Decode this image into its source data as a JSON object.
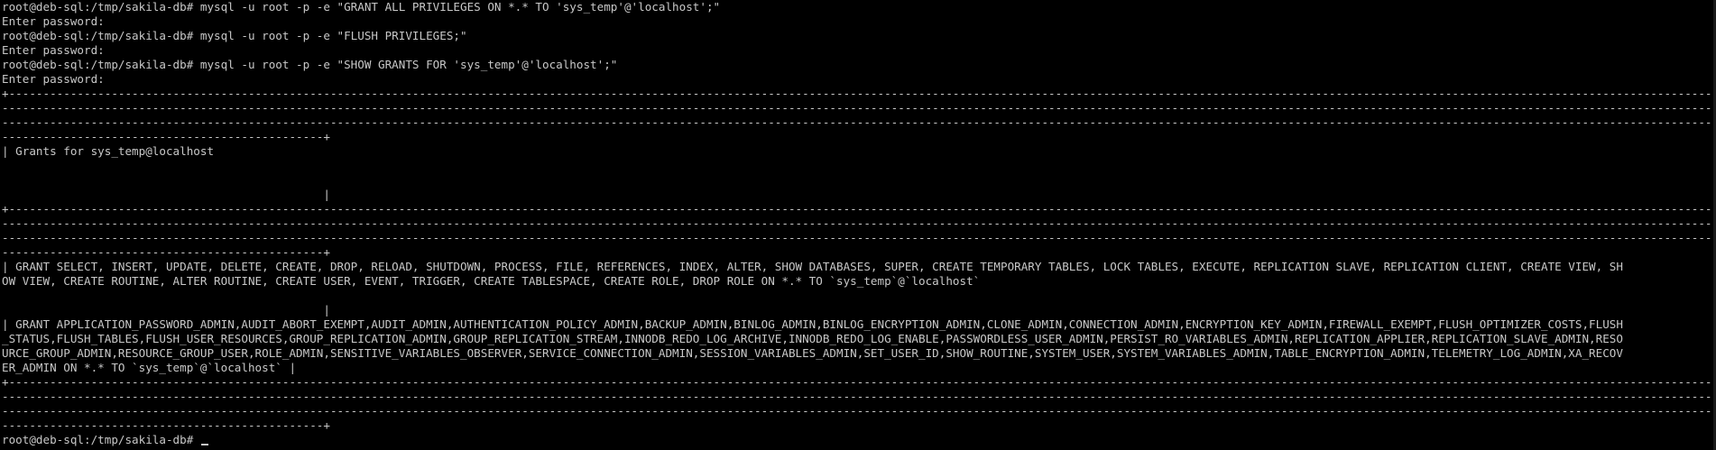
{
  "terminal": {
    "lines": [
      "root@deb-sql:/tmp/sakila-db# mysql -u root -p -e \"GRANT ALL PRIVILEGES ON *.* TO 'sys_temp'@'localhost';\"",
      "Enter password:",
      "root@deb-sql:/tmp/sakila-db# mysql -u root -p -e \"FLUSH PRIVILEGES;\"",
      "Enter password:",
      "root@deb-sql:/tmp/sakila-db# mysql -u root -p -e \"SHOW GRANTS FOR 'sys_temp'@'localhost';\"",
      "Enter password:",
      "+---------------------------------------------------------------------------------------------------------------------------------------------------------------------------------------------------------------------------------------------------------------------------",
      "-----------------------------------------------------------------------------------------------------------------------------------------------------------------------------------------------------------------------------------------------------------------------------",
      "-----------------------------------------------------------------------------------------------------------------------------------------------------------------------------------------------------------------------------------------------------------------------------",
      "-----------------------------------------------+",
      "| Grants for sys_temp@localhost",
      "",
      "",
      "                                               |",
      "+---------------------------------------------------------------------------------------------------------------------------------------------------------------------------------------------------------------------------------------------------------------------------",
      "-----------------------------------------------------------------------------------------------------------------------------------------------------------------------------------------------------------------------------------------------------------------------------",
      "-----------------------------------------------------------------------------------------------------------------------------------------------------------------------------------------------------------------------------------------------------------------------------",
      "-----------------------------------------------+",
      "| GRANT SELECT, INSERT, UPDATE, DELETE, CREATE, DROP, RELOAD, SHUTDOWN, PROCESS, FILE, REFERENCES, INDEX, ALTER, SHOW DATABASES, SUPER, CREATE TEMPORARY TABLES, LOCK TABLES, EXECUTE, REPLICATION SLAVE, REPLICATION CLIENT, CREATE VIEW, SH",
      "OW VIEW, CREATE ROUTINE, ALTER ROUTINE, CREATE USER, EVENT, TRIGGER, CREATE TABLESPACE, CREATE ROLE, DROP ROLE ON *.* TO `sys_temp`@`localhost`",
      "",
      "                                               |",
      "| GRANT APPLICATION_PASSWORD_ADMIN,AUDIT_ABORT_EXEMPT,AUDIT_ADMIN,AUTHENTICATION_POLICY_ADMIN,BACKUP_ADMIN,BINLOG_ADMIN,BINLOG_ENCRYPTION_ADMIN,CLONE_ADMIN,CONNECTION_ADMIN,ENCRYPTION_KEY_ADMIN,FIREWALL_EXEMPT,FLUSH_OPTIMIZER_COSTS,FLUSH",
      "_STATUS,FLUSH_TABLES,FLUSH_USER_RESOURCES,GROUP_REPLICATION_ADMIN,GROUP_REPLICATION_STREAM,INNODB_REDO_LOG_ARCHIVE,INNODB_REDO_LOG_ENABLE,PASSWORDLESS_USER_ADMIN,PERSIST_RO_VARIABLES_ADMIN,REPLICATION_APPLIER,REPLICATION_SLAVE_ADMIN,RESO",
      "URCE_GROUP_ADMIN,RESOURCE_GROUP_USER,ROLE_ADMIN,SENSITIVE_VARIABLES_OBSERVER,SERVICE_CONNECTION_ADMIN,SESSION_VARIABLES_ADMIN,SET_USER_ID,SHOW_ROUTINE,SYSTEM_USER,SYSTEM_VARIABLES_ADMIN,TABLE_ENCRYPTION_ADMIN,TELEMETRY_LOG_ADMIN,XA_RECOV",
      "ER_ADMIN ON *.* TO `sys_temp`@`localhost` |",
      "+---------------------------------------------------------------------------------------------------------------------------------------------------------------------------------------------------------------------------------------------------------------------------",
      "-----------------------------------------------------------------------------------------------------------------------------------------------------------------------------------------------------------------------------------------------------------------------------",
      "-----------------------------------------------------------------------------------------------------------------------------------------------------------------------------------------------------------------------------------------------------------------------------",
      "-----------------------------------------------+"
    ],
    "prompt": "root@deb-sql:/tmp/sakila-db# ",
    "colors": {
      "background": "#000000",
      "foreground": "#c8c8c8"
    }
  }
}
